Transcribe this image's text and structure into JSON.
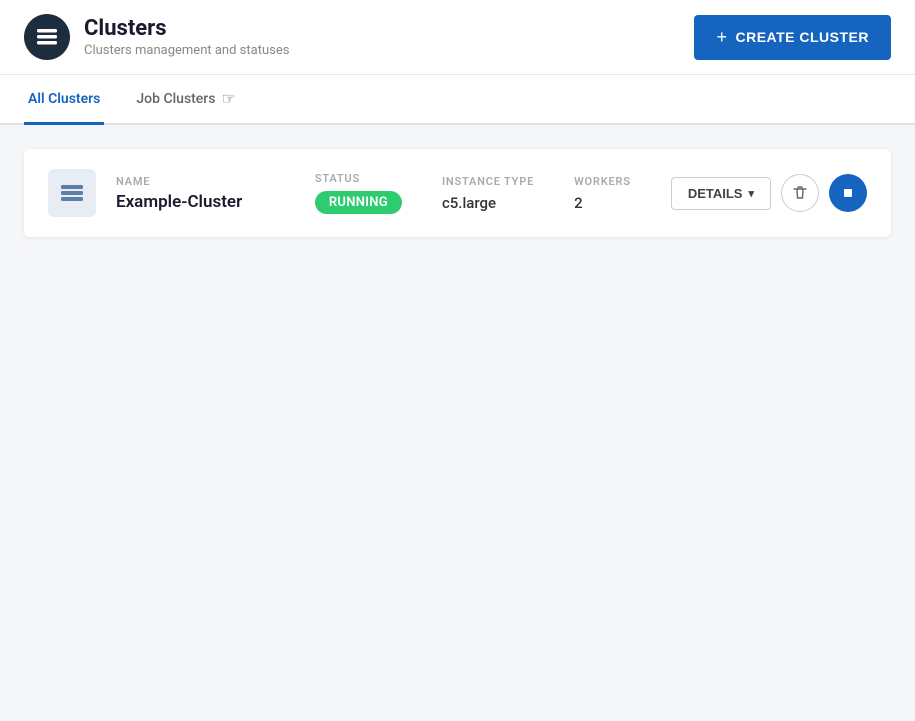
{
  "header": {
    "title": "Clusters",
    "subtitle": "Clusters management and statuses",
    "create_button_label": "CREATE CLUSTER",
    "logo_alt": "clusters-logo"
  },
  "tabs": [
    {
      "id": "all-clusters",
      "label": "All Clusters",
      "active": true
    },
    {
      "id": "job-clusters",
      "label": "Job Clusters",
      "active": false
    }
  ],
  "clusters": [
    {
      "name": "Example-Cluster",
      "status": "RUNNING",
      "instance_type": "c5.large",
      "workers": "2"
    }
  ],
  "table_headers": {
    "name": "NAME",
    "status": "STATUS",
    "instance_type": "INSTANCE TYPE",
    "workers": "WORKERS"
  },
  "actions": {
    "details_label": "DETAILS",
    "delete_label": "Delete",
    "stop_label": "Stop"
  }
}
